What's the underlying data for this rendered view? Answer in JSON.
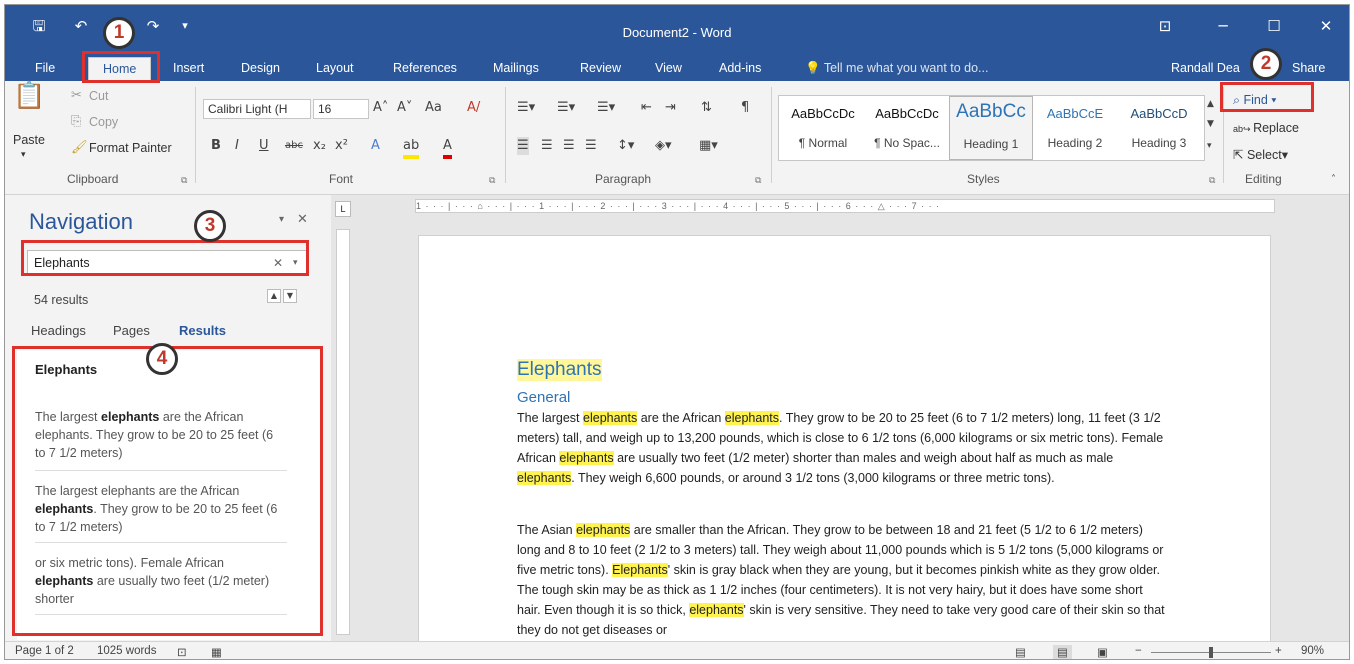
{
  "window": {
    "title": "Document2 - Word",
    "qat_save": "🖫",
    "qat_undo": "↶",
    "qat_redo": "↷",
    "qat_more": "▾",
    "ribbon_options": "⊡",
    "minimize": "─",
    "maximize": "☐",
    "close": "✕"
  },
  "tabs": [
    "File",
    "Home",
    "Insert",
    "Design",
    "Layout",
    "References",
    "Mailings",
    "Review",
    "View",
    "Add-ins"
  ],
  "tell_me": "Tell me what you want to do...",
  "user": "Randall Dea",
  "share": "Share",
  "clipboard": {
    "paste": "Paste",
    "cut": "Cut",
    "copy": "Copy",
    "format_painter": "Format Painter",
    "label": "Clipboard"
  },
  "font": {
    "name": "Calibri Light (H",
    "size": "16",
    "label": "Font",
    "bold": "B",
    "italic": "I",
    "underline": "U",
    "strike": "abc",
    "sub": "x₂",
    "sup": "x²",
    "grow": "A˄",
    "shrink": "A˅",
    "case": "Aa",
    "clear": "A/"
  },
  "paragraph": {
    "label": "Paragraph"
  },
  "styles": {
    "label": "Styles",
    "items": [
      {
        "preview": "AaBbCcDc",
        "name": "¶ Normal"
      },
      {
        "preview": "AaBbCcDc",
        "name": "¶ No Spac..."
      },
      {
        "preview": "AaBbCc",
        "name": "Heading 1"
      },
      {
        "preview": "AaBbCcE",
        "name": "Heading 2"
      },
      {
        "preview": "AaBbCcD",
        "name": "Heading 3"
      }
    ]
  },
  "editing": {
    "find": "Find",
    "replace": "Replace",
    "select": "Select",
    "label": "Editing"
  },
  "navigation": {
    "title": "Navigation",
    "search_value": "Elephants",
    "results_count": "54 results",
    "tabs": [
      "Headings",
      "Pages",
      "Results"
    ],
    "results": {
      "heading": "Elephants",
      "r1_pre": "The largest ",
      "r1_bold": "elephants",
      "r1_post": " are the African elephants. They grow to be 20 to 25 feet (6 to 7 1/2 meters)",
      "r2_pre": "The largest elephants are the African ",
      "r2_bold": "elephants",
      "r2_post": ". They grow to be 20 to 25 feet (6 to 7 1/2 meters)",
      "r3_pre": "or six metric tons). Female African ",
      "r3_bold": "elephants",
      "r3_post": " are usually two feet (1/2 meter) shorter"
    }
  },
  "ruler": "1 · · · | · · · ⌂ · · · | · · · 1 · · · | · · · 2 · · · | · · · 3 · · · | · · · 4 · · · | · · · 5 · · · | · · · 6 · · · △ · · · 7 · · ·",
  "document": {
    "heading": "Elephants",
    "subheading": "General",
    "p1": [
      "The largest ",
      "elephants",
      " are the African ",
      "elephants",
      ". They grow to be 20 to 25 feet (6 to 7 1/2 meters) long, 11 feet (3 1/2 meters) tall, and weigh up to 13,200 pounds, which is close to 6 1/2 tons (6,000 kilograms or six metric tons). Female African ",
      "elephants",
      " are usually two feet (1/2 meter) shorter than males and weigh about half as much as male ",
      "elephants",
      ". They weigh 6,600 pounds, or around 3 1/2 tons (3,000 kilograms or three metric tons)."
    ],
    "p2": [
      "The Asian ",
      "elephants",
      " are smaller than the African. They grow to be between 18 and 21 feet (5 1/2 to 6 1/2 meters) long and 8 to 10 feet (2 1/2 to 3 meters) tall. They weigh about 11,000 pounds which is 5 1/2 tons (5,000 kilograms or five metric tons). ",
      "Elephants",
      "' skin is gray black when they are young, but it becomes pinkish white as they grow older. The tough skin may be as thick as 1 1/2 inches (four centimeters). It is not very hairy, but it does have some short hair. Even though it is so thick, ",
      "elephants",
      "' skin is very sensitive. They need to take very good care of their skin so that they do not get diseases or"
    ]
  },
  "status": {
    "page": "Page 1 of 2",
    "words": "1025 words",
    "zoom": "90%",
    "zoom_minus": "−",
    "zoom_plus": "+"
  },
  "callouts": [
    "1",
    "2",
    "3",
    "4"
  ],
  "colors": {
    "accent": "#2b579a",
    "highlight": "#fff34f",
    "callout_box": "#e0302b"
  }
}
